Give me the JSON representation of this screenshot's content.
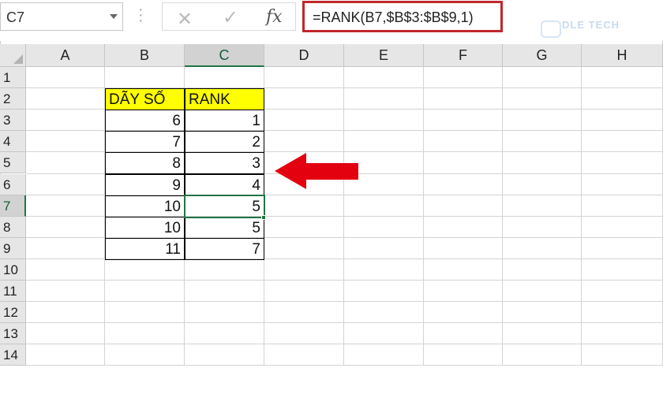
{
  "name_box": "C7",
  "formula_bar": {
    "cancel_icon": "close-icon",
    "enter_icon": "checkmark-icon",
    "function_label": "fx",
    "formula": "=RANK(B7,$B$3:$B$9,1)"
  },
  "watermark": "DLE TECH",
  "columns": [
    "A",
    "B",
    "C",
    "D",
    "E",
    "F",
    "G",
    "H"
  ],
  "rows": [
    "1",
    "2",
    "3",
    "4",
    "5",
    "6",
    "7",
    "8",
    "9",
    "10",
    "11",
    "12",
    "13",
    "14"
  ],
  "table": {
    "header": [
      "DÃY SỐ",
      "RANK"
    ],
    "rows": [
      {
        "b": "6",
        "c": "1"
      },
      {
        "b": "7",
        "c": "2"
      },
      {
        "b": "8",
        "c": "3"
      },
      {
        "b": "9",
        "c": "4"
      },
      {
        "b": "10",
        "c": "5"
      },
      {
        "b": "10",
        "c": "5"
      },
      {
        "b": "11",
        "c": "7"
      }
    ]
  },
  "colors": {
    "header_fill": "#ffff00",
    "selection": "#217346",
    "arrow": "#e3000f",
    "formula_highlight": "#c1272d"
  }
}
